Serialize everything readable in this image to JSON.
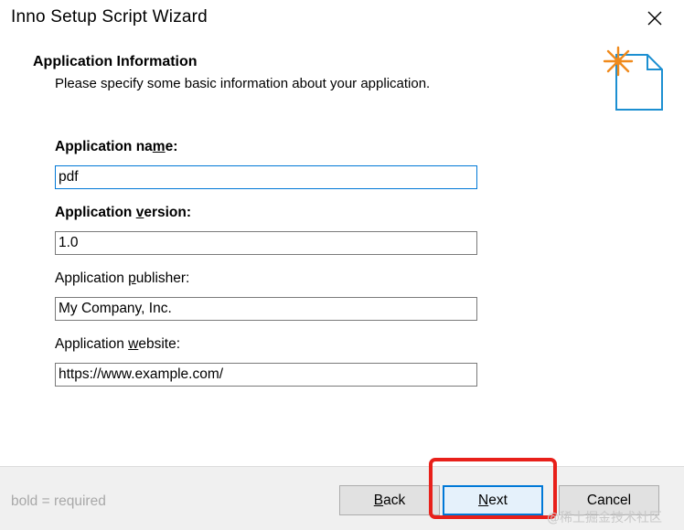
{
  "window": {
    "title": "Inno Setup Script Wizard"
  },
  "page": {
    "heading": "Application Information",
    "subheading": "Please specify some basic information about your application."
  },
  "fields": {
    "name": {
      "label_pre": "Application na",
      "label_mnemonic": "m",
      "label_post": "e:",
      "value": "pdf",
      "bold": true
    },
    "version": {
      "label_pre": "Application ",
      "label_mnemonic": "v",
      "label_post": "ersion:",
      "value": "1.0",
      "bold": true
    },
    "publisher": {
      "label_pre": "Application ",
      "label_mnemonic": "p",
      "label_post": "ublisher:",
      "value": "My Company, Inc.",
      "bold": false
    },
    "website": {
      "label_pre": "Application ",
      "label_mnemonic": "w",
      "label_post": "ebsite:",
      "value": "https://www.example.com/",
      "bold": false
    }
  },
  "footer": {
    "hint": "bold = required",
    "back": {
      "mnemonic": "B",
      "rest": "ack"
    },
    "next": {
      "mnemonic": "N",
      "rest": "ext"
    },
    "cancel": "Cancel"
  },
  "watermark": "@稀土掘金技术社区",
  "colors": {
    "accent": "#0078d7",
    "highlight": "#e8201a",
    "icon_star": "#f08a1c"
  },
  "icons": {
    "close": "close-icon",
    "wizard": "document-star-icon"
  }
}
